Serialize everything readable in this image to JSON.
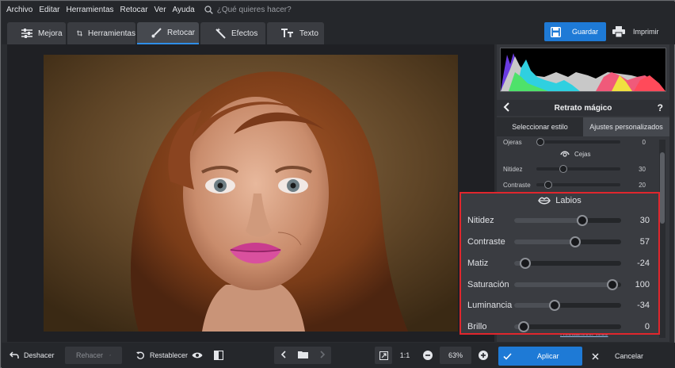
{
  "menu": {
    "items": [
      "Archivo",
      "Editar",
      "Herramientas",
      "Retocar",
      "Ver",
      "Ayuda"
    ],
    "search_placeholder": "¿Qué quieres hacer?"
  },
  "tabs": [
    {
      "label": "Mejora",
      "icon": "sliders-icon"
    },
    {
      "label": "Herramientas",
      "icon": "crop-icon"
    },
    {
      "label": "Retocar",
      "icon": "brush-icon",
      "active": true
    },
    {
      "label": "Efectos",
      "icon": "magic-wand-icon"
    },
    {
      "label": "Texto",
      "icon": "text-icon"
    }
  ],
  "toolbar": {
    "save_label": "Guardar",
    "print_label": "Imprimir"
  },
  "panel": {
    "title": "Retrato mágico",
    "help": "?",
    "subtabs": [
      "Seleccionar estilo",
      "Ajustes personalizados"
    ],
    "ojeras": {
      "label": "Ojeras",
      "value": "0",
      "level": 0.0
    },
    "cejas_title": "Cejas",
    "cejas": [
      {
        "label": "Nitidez",
        "value": "30",
        "level": 0.3
      },
      {
        "label": "Contraste",
        "value": "20",
        "level": 0.1
      }
    ],
    "reset_link": "Restablecer todo"
  },
  "labios": {
    "title": "Labios",
    "rows": [
      {
        "label": "Nitidez",
        "value": "30",
        "level": 0.65
      },
      {
        "label": "Contraste",
        "value": "57",
        "level": 0.58
      },
      {
        "label": "Matiz",
        "value": "-24",
        "level": 0.06
      },
      {
        "label": "Saturación",
        "value": "100",
        "level": 0.97
      },
      {
        "label": "Luminancia",
        "value": "-34",
        "level": 0.36
      },
      {
        "label": "Brillo",
        "value": "0",
        "level": 0.04
      }
    ]
  },
  "bottom": {
    "undo": "Deshacer",
    "redo": "Rehacer",
    "reset": "Restablecer",
    "ratio": "1:1",
    "zoom": "63%",
    "apply": "Aplicar",
    "cancel": "Cancelar"
  },
  "colors": {
    "accent": "#1e7ad6",
    "highlight": "#e0262d"
  }
}
